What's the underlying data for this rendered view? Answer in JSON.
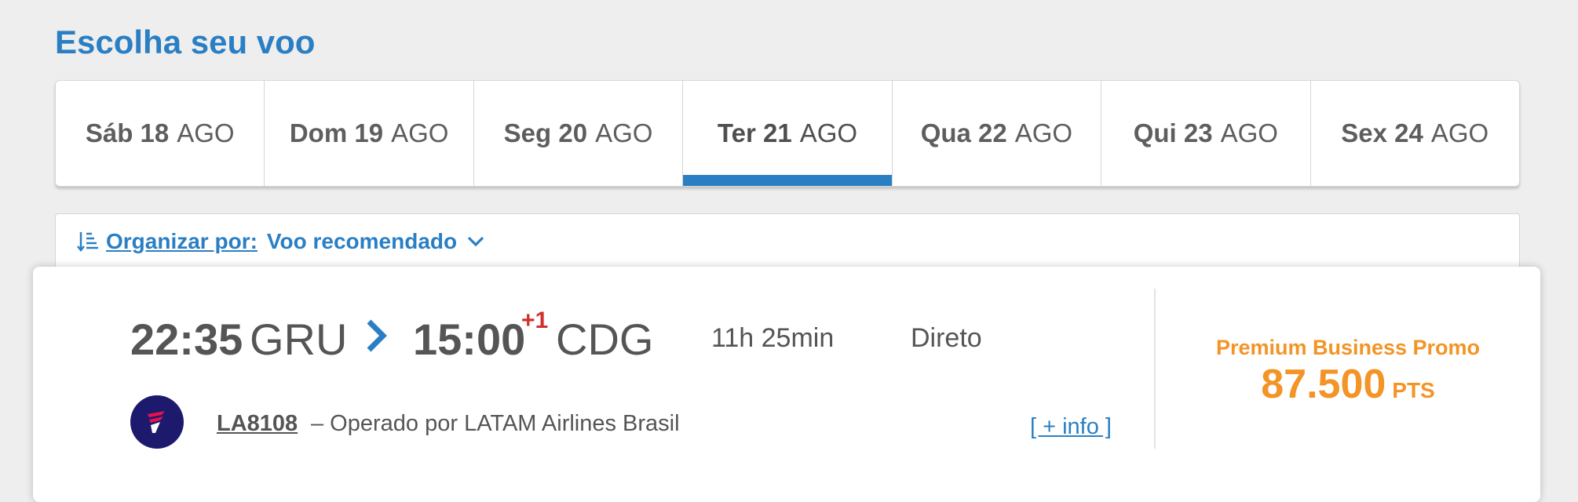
{
  "page": {
    "title": "Escolha seu voo"
  },
  "dates": [
    {
      "day": "Sáb 18",
      "month": "AGO",
      "active": false
    },
    {
      "day": "Dom 19",
      "month": "AGO",
      "active": false
    },
    {
      "day": "Seg 20",
      "month": "AGO",
      "active": false
    },
    {
      "day": "Ter 21",
      "month": "AGO",
      "active": true
    },
    {
      "day": "Qua 22",
      "month": "AGO",
      "active": false
    },
    {
      "day": "Qui 23",
      "month": "AGO",
      "active": false
    },
    {
      "day": "Sex 24",
      "month": "AGO",
      "active": false
    }
  ],
  "sort": {
    "label": "Organizar por:",
    "value": "Voo recomendado",
    "icon": "sort-icon"
  },
  "flight": {
    "departure_time": "22:35",
    "departure_airport": "GRU",
    "arrival_time": "15:00",
    "day_offset": "+1",
    "arrival_airport": "CDG",
    "duration": "11h 25min",
    "stops": "Direto",
    "flight_number": "LA8108",
    "operated_by": "– Operado por LATAM Airlines Brasil",
    "more_info": "[ + info ]",
    "airline_logo": "latam-logo"
  },
  "fare": {
    "name": "Premium Business Promo",
    "price": "87.500",
    "unit": "PTS"
  },
  "colors": {
    "accent": "#2a7fc4",
    "fare": "#f39426",
    "offset": "#d0312d",
    "logo_bg": "#1d1a6e"
  }
}
